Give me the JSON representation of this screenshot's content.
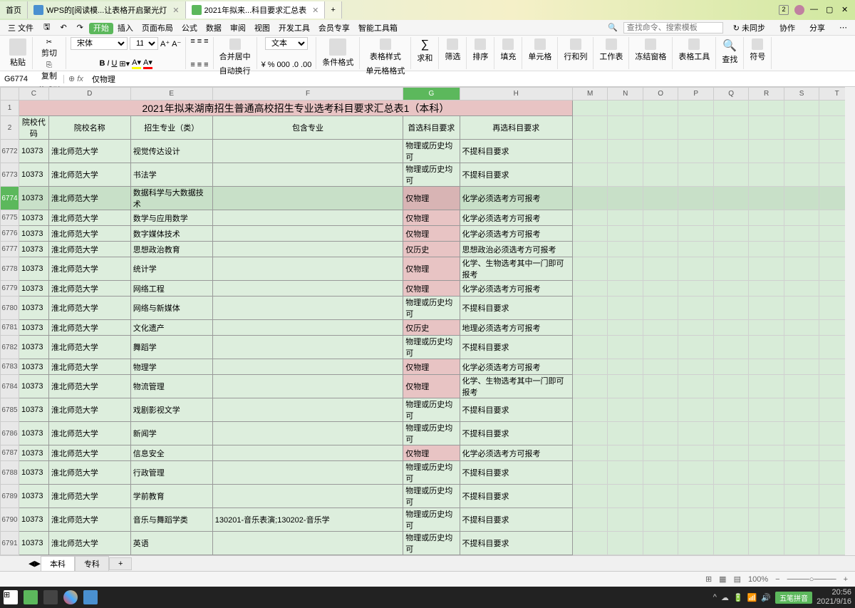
{
  "titlebar": {
    "home": "首页",
    "tab1": "WPS的[阅读模...让表格开启聚光灯",
    "tab2": "2021年拟来...科目要求汇总表"
  },
  "menu": {
    "file": "三 文件",
    "items": [
      "开始",
      "插入",
      "页面布局",
      "公式",
      "数据",
      "审阅",
      "视图",
      "开发工具",
      "会员专享",
      "智能工具箱"
    ],
    "search_placeholder": "查找命令、搜索模板",
    "right": [
      "未同步",
      "协作",
      "分享"
    ]
  },
  "ribbon": {
    "paste": "粘贴",
    "cut": "剪切",
    "copy": "复制",
    "format_painter": "格式刷",
    "font": "宋体",
    "size": "11",
    "text": "文本",
    "merge": "合并居中",
    "auto_wrap": "自动换行",
    "cond_format": "条件格式",
    "cell_format": "单元格格式",
    "table_style": "表格样式",
    "sum": "求和",
    "filter": "筛选",
    "sort": "排序",
    "fill": "填充",
    "cell": "单元格",
    "row_col": "行和列",
    "sheet": "工作表",
    "freeze": "冻结窗格",
    "table_tool": "表格工具",
    "find": "查找",
    "symbol": "符号"
  },
  "formula": {
    "cell": "G6774",
    "value": "仅物理"
  },
  "cols": [
    "C",
    "D",
    "E",
    "F",
    "G",
    "H",
    "M",
    "N",
    "O",
    "P",
    "Q",
    "R",
    "S",
    "T"
  ],
  "title_row": "2021年拟来湖南招生普通高校招生专业选考科目要求汇总表1（本科）",
  "headers": {
    "c": "院校代码",
    "d": "院校名称",
    "e": "招生专业（类）",
    "f": "包含专业",
    "g": "首选科目要求",
    "h": "再选科目要求"
  },
  "rows": [
    {
      "n": "6772",
      "c": "10373",
      "d": "淮北师范大学",
      "e": "视觉传达设计",
      "f": "",
      "g": "物理或历史均可",
      "gp": 0,
      "h": "不提科目要求"
    },
    {
      "n": "6773",
      "c": "10373",
      "d": "淮北师范大学",
      "e": "书法学",
      "f": "",
      "g": "物理或历史均可",
      "gp": 0,
      "h": "不提科目要求"
    },
    {
      "n": "6774",
      "c": "10373",
      "d": "淮北师范大学",
      "e": "数据科学与大数据技术",
      "f": "",
      "g": "仅物理",
      "gp": 1,
      "h": "化学必须选考方可报考",
      "sel": 1
    },
    {
      "n": "6775",
      "c": "10373",
      "d": "淮北师范大学",
      "e": "数学与应用数学",
      "f": "",
      "g": "仅物理",
      "gp": 1,
      "h": "化学必须选考方可报考"
    },
    {
      "n": "6776",
      "c": "10373",
      "d": "淮北师范大学",
      "e": "数字媒体技术",
      "f": "",
      "g": "仅物理",
      "gp": 1,
      "h": "化学必须选考方可报考"
    },
    {
      "n": "6777",
      "c": "10373",
      "d": "淮北师范大学",
      "e": "思想政治教育",
      "f": "",
      "g": "仅历史",
      "gp": 1,
      "h": "思想政治必须选考方可报考"
    },
    {
      "n": "6778",
      "c": "10373",
      "d": "淮北师范大学",
      "e": "统计学",
      "f": "",
      "g": "仅物理",
      "gp": 1,
      "h": "化学、生物选考其中一门即可报考"
    },
    {
      "n": "6779",
      "c": "10373",
      "d": "淮北师范大学",
      "e": "网络工程",
      "f": "",
      "g": "仅物理",
      "gp": 1,
      "h": "化学必须选考方可报考"
    },
    {
      "n": "6780",
      "c": "10373",
      "d": "淮北师范大学",
      "e": "网络与新媒体",
      "f": "",
      "g": "物理或历史均可",
      "gp": 0,
      "h": "不提科目要求"
    },
    {
      "n": "6781",
      "c": "10373",
      "d": "淮北师范大学",
      "e": "文化遗产",
      "f": "",
      "g": "仅历史",
      "gp": 1,
      "h": "地理必须选考方可报考"
    },
    {
      "n": "6782",
      "c": "10373",
      "d": "淮北师范大学",
      "e": "舞蹈学",
      "f": "",
      "g": "物理或历史均可",
      "gp": 0,
      "h": "不提科目要求"
    },
    {
      "n": "6783",
      "c": "10373",
      "d": "淮北师范大学",
      "e": "物理学",
      "f": "",
      "g": "仅物理",
      "gp": 1,
      "h": "化学必须选考方可报考"
    },
    {
      "n": "6784",
      "c": "10373",
      "d": "淮北师范大学",
      "e": "物流管理",
      "f": "",
      "g": "仅物理",
      "gp": 1,
      "h": "化学、生物选考其中一门即可报考"
    },
    {
      "n": "6785",
      "c": "10373",
      "d": "淮北师范大学",
      "e": "戏剧影视文学",
      "f": "",
      "g": "物理或历史均可",
      "gp": 0,
      "h": "不提科目要求"
    },
    {
      "n": "6786",
      "c": "10373",
      "d": "淮北师范大学",
      "e": "新闻学",
      "f": "",
      "g": "物理或历史均可",
      "gp": 0,
      "h": "不提科目要求"
    },
    {
      "n": "6787",
      "c": "10373",
      "d": "淮北师范大学",
      "e": "信息安全",
      "f": "",
      "g": "仅物理",
      "gp": 1,
      "h": "化学必须选考方可报考"
    },
    {
      "n": "6788",
      "c": "10373",
      "d": "淮北师范大学",
      "e": "行政管理",
      "f": "",
      "g": "物理或历史均可",
      "gp": 0,
      "h": "不提科目要求"
    },
    {
      "n": "6789",
      "c": "10373",
      "d": "淮北师范大学",
      "e": "学前教育",
      "f": "",
      "g": "物理或历史均可",
      "gp": 0,
      "h": "不提科目要求"
    },
    {
      "n": "6790",
      "c": "10373",
      "d": "淮北师范大学",
      "e": "音乐与舞蹈学类",
      "f": "130201-音乐表演;130202-音乐学",
      "g": "物理或历史均可",
      "gp": 0,
      "h": "不提科目要求"
    },
    {
      "n": "6791",
      "c": "10373",
      "d": "淮北师范大学",
      "e": "英语",
      "f": "",
      "g": "物理或历史均可",
      "gp": 0,
      "h": "不提科目要求"
    }
  ],
  "sheets": {
    "s1": "本科",
    "s2": "专科"
  },
  "status": {
    "zoom": "100%",
    "ime": "五笔拼音"
  },
  "clock": {
    "time": "20:56",
    "date": "2021/9/16"
  }
}
